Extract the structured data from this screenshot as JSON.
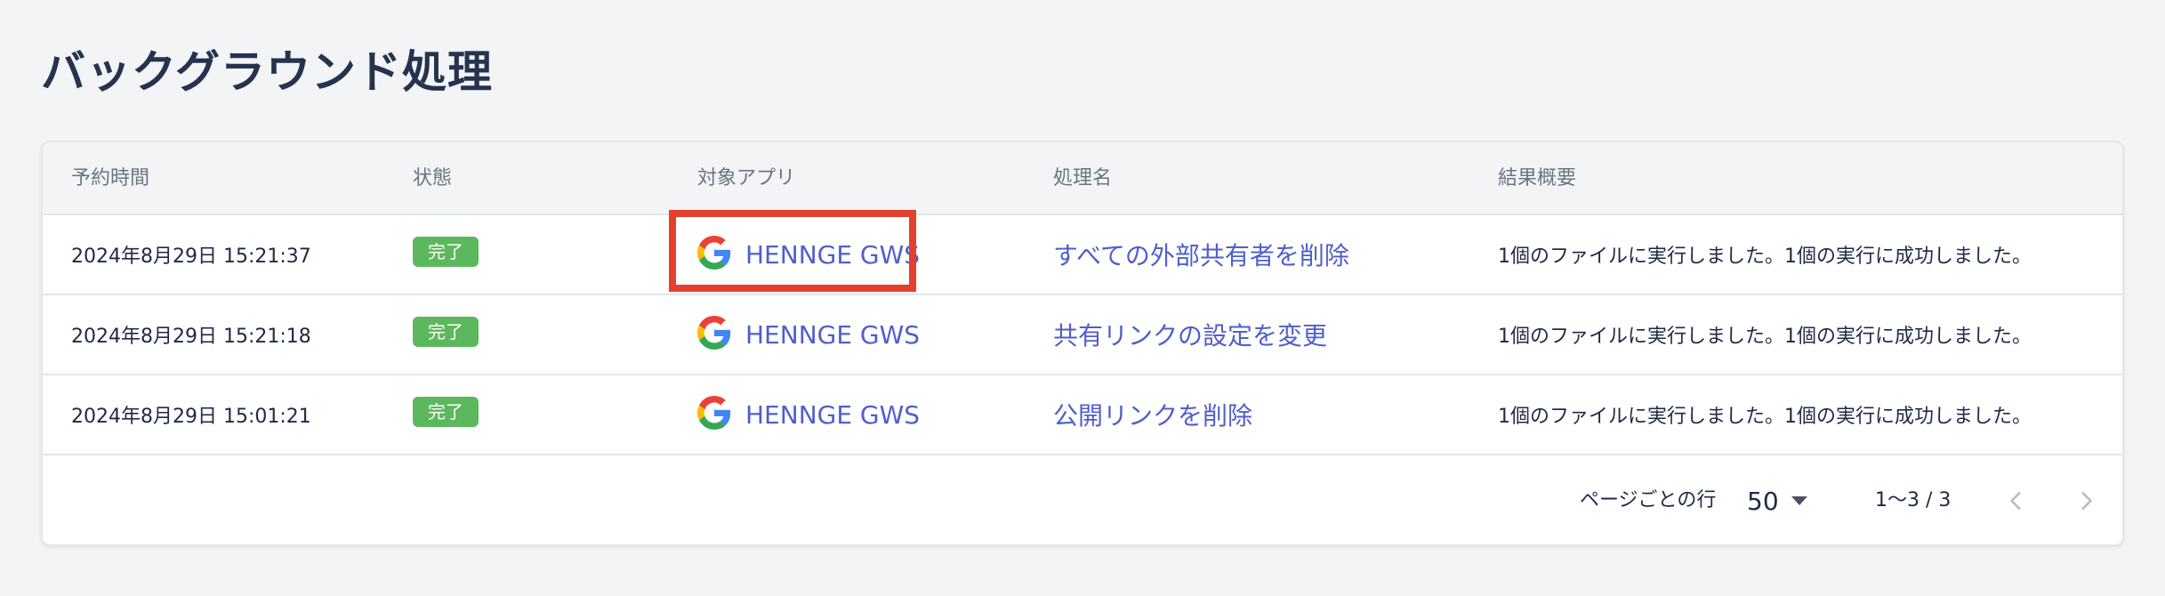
{
  "page": {
    "title": "バックグラウンド処理"
  },
  "table": {
    "headers": {
      "scheduled_time": "予約時間",
      "status": "状態",
      "target_app": "対象アプリ",
      "process_name": "処理名",
      "result_summary": "結果概要"
    },
    "rows": [
      {
        "scheduled_time": "2024年8月29日 15:21:37",
        "status": "完了",
        "app_icon": "google-g-icon",
        "target_app": "HENNGE GWS",
        "process_name": "すべての外部共有者を削除",
        "result_summary": "1個のファイルに実行しました。1個の実行に成功しました。"
      },
      {
        "scheduled_time": "2024年8月29日 15:21:18",
        "status": "完了",
        "app_icon": "google-g-icon",
        "target_app": "HENNGE GWS",
        "process_name": "共有リンクの設定を変更",
        "result_summary": "1個のファイルに実行しました。1個の実行に成功しました。"
      },
      {
        "scheduled_time": "2024年8月29日 15:01:21",
        "status": "完了",
        "app_icon": "google-g-icon",
        "target_app": "HENNGE GWS",
        "process_name": "公開リンクを削除",
        "result_summary": "1個のファイルに実行しました。1個の実行に成功しました。"
      }
    ]
  },
  "pagination": {
    "rows_per_page_label": "ページごとの行",
    "rows_per_page_value": "50",
    "range_text": "1〜3 / 3",
    "prev_icon": "chevron-left-icon",
    "next_icon": "chevron-right-icon"
  },
  "colors": {
    "status_complete": "#5cb85c",
    "link": "#4f5fcc",
    "highlight": "#e2412e"
  }
}
